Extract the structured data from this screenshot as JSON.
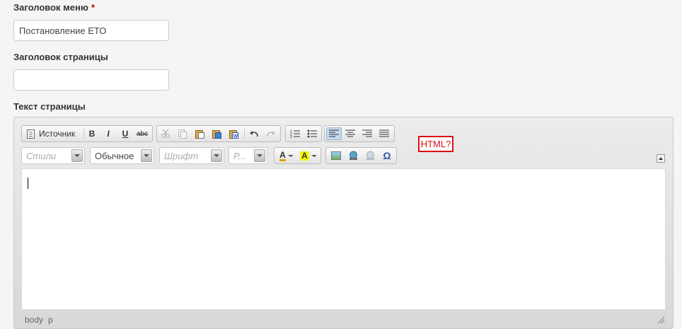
{
  "fields": {
    "menu_title_label": "Заголовок меню",
    "required_mark": "*",
    "menu_title_value": "Постановление ЕТО",
    "page_title_label": "Заголовок страницы",
    "page_title_value": "",
    "page_text_label": "Текст страницы"
  },
  "toolbar": {
    "source_label": "Источник",
    "bold": "B",
    "italic": "I",
    "underline": "U",
    "strike": "abc",
    "styles_placeholder": "Стили",
    "format_value": "Обычное",
    "font_placeholder": "Шрифт",
    "size_placeholder": "Р...",
    "text_color_glyph": "A",
    "bg_color_glyph": "A",
    "special_char": "Ω"
  },
  "help_link": "HTML?",
  "statusbar": {
    "path": [
      "body",
      "p"
    ]
  },
  "colors": {
    "accent_red": "#d11111",
    "active_button": "#c6d9ef"
  }
}
